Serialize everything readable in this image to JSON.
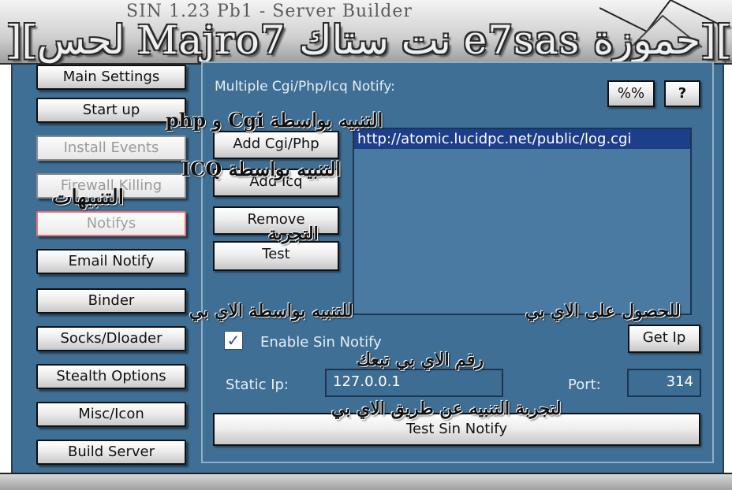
{
  "window": {
    "title": "SIN 1.23 Pb1 - Server Builder",
    "banner": "][لحس Majro7 نت ستاك e7sas حموزة]["
  },
  "sidebar": {
    "items": [
      {
        "label": "Main Settings",
        "state": "normal"
      },
      {
        "label": "Start up",
        "state": "normal"
      },
      {
        "label": "Install Events",
        "state": "disabled"
      },
      {
        "label": "Firewall Killing",
        "state": "disabled"
      },
      {
        "label": "Notifys",
        "state": "active"
      },
      {
        "label": "Email Notify",
        "state": "normal"
      },
      {
        "label": "Binder",
        "state": "normal"
      },
      {
        "label": "Socks/Dloader",
        "state": "normal"
      },
      {
        "label": "Stealth Options",
        "state": "normal"
      },
      {
        "label": "Misc/Icon",
        "state": "normal"
      },
      {
        "label": "Build Server",
        "state": "normal"
      }
    ]
  },
  "notify": {
    "section_label": "Multiple Cgi/Php/Icq Notify:",
    "percent_button": "%%",
    "help_button": "?",
    "add_cgi_button": "Add Cgi/Php",
    "add_icq_button": "Add Icq",
    "remove_button": "Remove",
    "test_button": "Test",
    "list_items": [
      "http://atomic.lucidpc.net/public/log.cgi"
    ],
    "enable_sin_label": "Enable Sin Notify",
    "enable_sin_checked": true,
    "get_ip_button": "Get Ip",
    "static_ip_label": "Static Ip:",
    "static_ip_value": "127.0.0.1",
    "port_label": "Port:",
    "port_value": "314",
    "test_sin_button": "Test Sin Notify"
  },
  "annotations": {
    "notifications": "التنبيهات",
    "cgi_php": "التنبيه بواسطة Cgi و php",
    "icq": "التنبيه بواسطة ICQ",
    "experiment": "التجربة",
    "ip_notify": "للتنبيه بواسطة الاي بي",
    "get_ip": "للحصول على الاي بي",
    "ip_number": "رقم الاي بي تبعك",
    "test_ip": "لتجربة التنبيه عن طريق الاي بي"
  },
  "colors": {
    "panel_bg": "#3f6f94",
    "list_selection": "#1d3e8a",
    "active_border": "#e57373"
  }
}
